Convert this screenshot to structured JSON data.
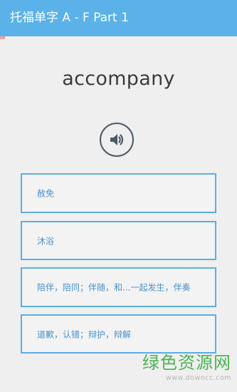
{
  "header": {
    "title": "托福单字 A - F Part 1"
  },
  "card": {
    "word": "accompany",
    "speak_icon": "speaker-volume-icon"
  },
  "options": [
    {
      "label": "赦免"
    },
    {
      "label": "沐浴"
    },
    {
      "label": "陪伴，陪同；伴随，和...一起发生，伴奏"
    },
    {
      "label": "道歉，认错；辩护，辩解"
    }
  ],
  "colors": {
    "header_bg": "#5ab2e9",
    "option_border": "#5aaee6",
    "option_text": "#4a92d0",
    "word_text": "#3b3b3b",
    "background": "#efefef"
  },
  "watermark": {
    "text": "绿色资源网",
    "url": "www.downcc.com"
  }
}
